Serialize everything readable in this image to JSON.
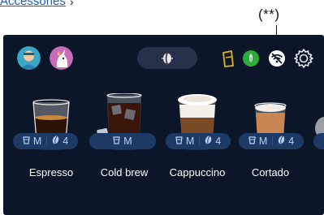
{
  "doc_link": "Accessories",
  "doc_arrow": "›",
  "callout_label": "(**)",
  "avatars": [
    {
      "name": "avatar-user-1",
      "icon": "profile-face-icon",
      "color": "#3aa7c9"
    },
    {
      "name": "avatar-user-2",
      "icon": "unicorn-profile-icon",
      "color": "#c86bb8"
    }
  ],
  "status_icons": [
    "water-tank-icon",
    "eco-leaf-icon",
    "wifi-off-icon",
    "settings-gear-icon"
  ],
  "profile_pill_icon": "coffee-bean-icon",
  "beverages": [
    {
      "name": "Espresso",
      "size": "M",
      "strength": "4"
    },
    {
      "name": "Cold brew",
      "size": "M",
      "strength": ""
    },
    {
      "name": "Cappuccino",
      "size": "M",
      "strength": "4"
    },
    {
      "name": "Cortado",
      "size": "M",
      "strength": "4"
    }
  ],
  "colors": {
    "screen_bg": "#0b1628",
    "pill_bg": "#1d3a66",
    "pill_text": "#b9d1f4",
    "eco_green": "#2eab3a",
    "tank_yellow": "#e2b21d"
  }
}
